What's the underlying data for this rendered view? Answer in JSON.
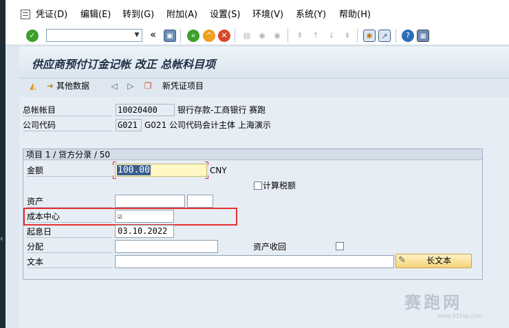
{
  "menu": [
    {
      "label": "凭证(D)"
    },
    {
      "label": "编辑(E)"
    },
    {
      "label": "转到(G)"
    },
    {
      "label": "附加(A)"
    },
    {
      "label": "设置(S)"
    },
    {
      "label": "环境(V)"
    },
    {
      "label": "系统(Y)"
    },
    {
      "label": "帮助(H)"
    }
  ],
  "toolbar": {
    "command_field_value": "",
    "back_label": "«"
  },
  "title": "供应商预付订金记帐 改正 总帐科目项",
  "app_toolbar": {
    "other_data_label": "其他数据",
    "new_doc_item_label": "新凭证项目"
  },
  "header": {
    "gl_account_label": "总帐帐目",
    "gl_account_value": "10020400",
    "gl_account_desc": "银行存款-工商银行 赛跑",
    "company_code_label": "公司代码",
    "company_code_value": "G021",
    "company_code_desc": "G021 公司代码会计主体 上海演示"
  },
  "item": {
    "frame_title": "项目 1 / 贷方分录 / 50",
    "amount_label": "金额",
    "amount_value": "100.00",
    "currency": "CNY",
    "calc_tax_label": "计算税额",
    "asset_label": "资产",
    "asset_value": "",
    "asset_sub_value": "",
    "cost_center_label": "成本中心",
    "cost_center_value": "☑",
    "value_date_label": "起息日",
    "value_date_value": "03.10.2022",
    "assignment_label": "分配",
    "assignment_value": "",
    "asset_retirement_label": "资产收回",
    "text_label": "文本",
    "text_value": "",
    "long_text_label": "长文本"
  },
  "watermark": {
    "text": "赛跑网",
    "url": "www.915sp.com"
  },
  "colors": {
    "accent_red": "#e53030",
    "amount_bg": "#fff7c4",
    "ok_green": "#3aa02a"
  }
}
